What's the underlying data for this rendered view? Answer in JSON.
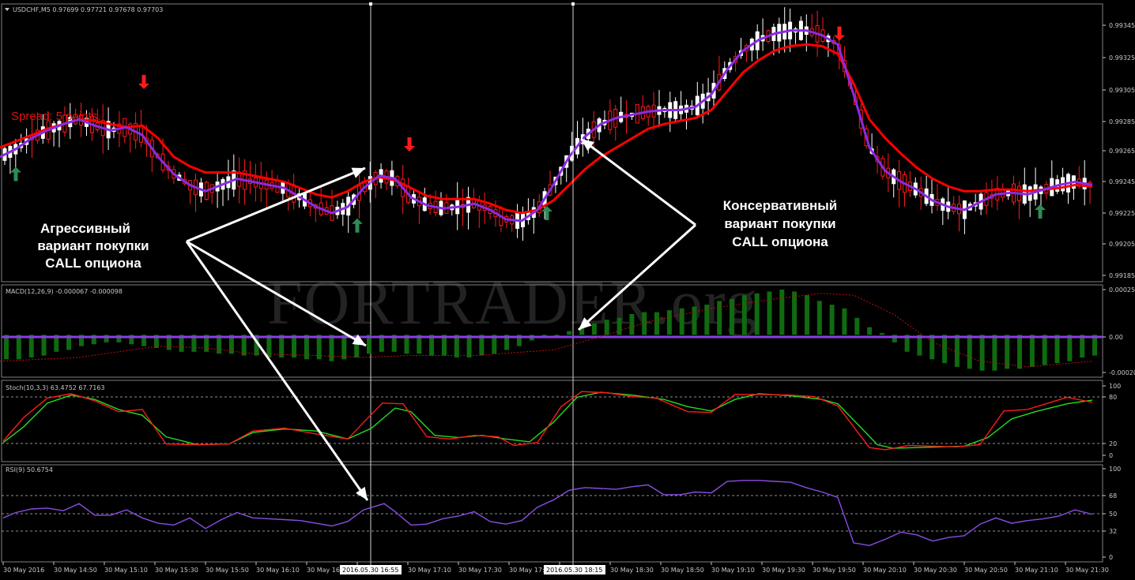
{
  "colors": {
    "background": "#000000",
    "frame": "#808080",
    "grid": "#c0c0c0",
    "bull_candle": "#ffffff",
    "bear_candle": "#ff1a1a",
    "fast_ma": "#8a2be2",
    "slow_ma": "#ff0000",
    "macd_hist": "#0f6b0f",
    "macd_signal": "#c01010",
    "stoch_main": "#ff1a1a",
    "stoch_signal": "#22dd22",
    "rsi_line": "#8a4de2",
    "arrow_up": "#2e8b57",
    "arrow_down": "#ff1a1a",
    "annotation": "#ffffff"
  },
  "main_panel": {
    "label": "USDCHF,M5  0.97699 0.97721 0.97678 0.97703",
    "menu_icon": "triangle-down-icon",
    "price_ticks": [
      "0.99345",
      "0.99325",
      "0.99305",
      "0.99285",
      "0.99265",
      "0.99245",
      "0.99225",
      "0.99205",
      "0.99185"
    ],
    "spread_text": "Spread: 5 points."
  },
  "annotations": {
    "aggressive": [
      "Агрессивный",
      "вариант покупки",
      "CALL опциона"
    ],
    "conservative": [
      "Консервативный",
      "вариант покупки",
      "CALL опциона"
    ]
  },
  "watermark": "FORTRADER.org",
  "macd_panel": {
    "label": "MACD(12,26,9) -0.000067 -0.000098",
    "ticks": [
      "0.000255",
      "0.00",
      "-0.000203"
    ]
  },
  "stoch_panel": {
    "label": "Stoch(10,3,3) 63.4752 67.7163",
    "ticks": [
      "100",
      "80",
      "20",
      "0"
    ]
  },
  "rsi_panel": {
    "label": "RSI(9) 50.6754",
    "ticks": [
      "100",
      "68",
      "50",
      "32",
      "0"
    ]
  },
  "time_axis": {
    "labels": [
      "30 May 2016",
      "30 May 14:50",
      "30 May 15:10",
      "30 May 15:30",
      "30 May 15:50",
      "30 May 16:10",
      "30 May 16:30",
      "30 May 16:55",
      "30 May 17:10",
      "30 May 17:30",
      "30 May 17:50",
      "30 May 18:15",
      "30 May 18:30",
      "30 May 18:50",
      "30 May 19:10",
      "30 May 19:30",
      "30 May 19:50",
      "30 May 20:10",
      "30 May 20:30",
      "30 May 20:50",
      "30 May 21:10",
      "30 May 21:30"
    ],
    "crosshair_labels": [
      "2016.05.30 16:55",
      "2016.05.30 18:15"
    ]
  },
  "chart_data": {
    "type": "candlestick",
    "symbol": "USDCHF",
    "timeframe": "M5",
    "price_range": [
      0.99178,
      0.99356
    ],
    "slow_ma_pts": [
      [
        0,
        0.99264
      ],
      [
        20,
        0.99268
      ],
      [
        40,
        0.99272
      ],
      [
        60,
        0.99276
      ],
      [
        80,
        0.99279
      ],
      [
        100,
        0.99282
      ],
      [
        120,
        0.99281
      ],
      [
        140,
        0.99279
      ],
      [
        160,
        0.99277
      ],
      [
        180,
        0.99278
      ],
      [
        200,
        0.9927
      ],
      [
        220,
        0.99258
      ],
      [
        240,
        0.99252
      ],
      [
        260,
        0.99248
      ],
      [
        280,
        0.99248
      ],
      [
        300,
        0.99248
      ],
      [
        320,
        0.99246
      ],
      [
        340,
        0.99244
      ],
      [
        360,
        0.99242
      ],
      [
        380,
        0.99238
      ],
      [
        400,
        0.99234
      ],
      [
        420,
        0.99232
      ],
      [
        440,
        0.99236
      ],
      [
        460,
        0.99242
      ],
      [
        480,
        0.99245
      ],
      [
        500,
        0.99243
      ],
      [
        520,
        0.99238
      ],
      [
        540,
        0.99233
      ],
      [
        560,
        0.99231
      ],
      [
        580,
        0.99231
      ],
      [
        600,
        0.99231
      ],
      [
        620,
        0.99228
      ],
      [
        640,
        0.99224
      ],
      [
        660,
        0.99222
      ],
      [
        680,
        0.99224
      ],
      [
        700,
        0.9923
      ],
      [
        720,
        0.9924
      ],
      [
        740,
        0.9925
      ],
      [
        760,
        0.99258
      ],
      [
        780,
        0.99264
      ],
      [
        800,
        0.9927
      ],
      [
        820,
        0.99276
      ],
      [
        840,
        0.99279
      ],
      [
        860,
        0.99281
      ],
      [
        880,
        0.99283
      ],
      [
        900,
        0.99288
      ],
      [
        920,
        0.993
      ],
      [
        940,
        0.99312
      ],
      [
        960,
        0.9932
      ],
      [
        980,
        0.99326
      ],
      [
        1000,
        0.99329
      ],
      [
        1020,
        0.9933
      ],
      [
        1040,
        0.99329
      ],
      [
        1060,
        0.99324
      ],
      [
        1080,
        0.99305
      ],
      [
        1100,
        0.99282
      ],
      [
        1120,
        0.9927
      ],
      [
        1140,
        0.9926
      ],
      [
        1160,
        0.99251
      ],
      [
        1180,
        0.99244
      ],
      [
        1200,
        0.99239
      ],
      [
        1220,
        0.99236
      ],
      [
        1240,
        0.99236
      ],
      [
        1260,
        0.99237
      ],
      [
        1280,
        0.99237
      ],
      [
        1300,
        0.99236
      ],
      [
        1320,
        0.99237
      ],
      [
        1340,
        0.99238
      ],
      [
        1360,
        0.9924
      ],
      [
        1382,
        0.99239
      ]
    ],
    "fast_ma_pts": [
      [
        0,
        0.99258
      ],
      [
        20,
        0.99263
      ],
      [
        40,
        0.9927
      ],
      [
        60,
        0.99275
      ],
      [
        80,
        0.99279
      ],
      [
        100,
        0.99282
      ],
      [
        120,
        0.99278
      ],
      [
        140,
        0.99275
      ],
      [
        160,
        0.99277
      ],
      [
        180,
        0.99272
      ],
      [
        200,
        0.99258
      ],
      [
        220,
        0.99247
      ],
      [
        240,
        0.9924
      ],
      [
        260,
        0.99236
      ],
      [
        280,
        0.9924
      ],
      [
        300,
        0.99244
      ],
      [
        320,
        0.99242
      ],
      [
        340,
        0.9924
      ],
      [
        360,
        0.99238
      ],
      [
        380,
        0.99232
      ],
      [
        400,
        0.99226
      ],
      [
        420,
        0.99222
      ],
      [
        440,
        0.99226
      ],
      [
        460,
        0.99238
      ],
      [
        480,
        0.99246
      ],
      [
        500,
        0.99244
      ],
      [
        520,
        0.99232
      ],
      [
        540,
        0.99227
      ],
      [
        560,
        0.99225
      ],
      [
        580,
        0.99226
      ],
      [
        600,
        0.99228
      ],
      [
        620,
        0.99224
      ],
      [
        640,
        0.99218
      ],
      [
        660,
        0.99217
      ],
      [
        680,
        0.99224
      ],
      [
        700,
        0.9924
      ],
      [
        720,
        0.99258
      ],
      [
        740,
        0.99271
      ],
      [
        760,
        0.99279
      ],
      [
        780,
        0.99283
      ],
      [
        800,
        0.99285
      ],
      [
        820,
        0.99287
      ],
      [
        840,
        0.99288
      ],
      [
        860,
        0.99288
      ],
      [
        880,
        0.9929
      ],
      [
        900,
        0.99298
      ],
      [
        920,
        0.99314
      ],
      [
        940,
        0.99326
      ],
      [
        960,
        0.99333
      ],
      [
        980,
        0.99337
      ],
      [
        1000,
        0.99339
      ],
      [
        1020,
        0.99339
      ],
      [
        1040,
        0.99336
      ],
      [
        1060,
        0.9933
      ],
      [
        1080,
        0.99298
      ],
      [
        1100,
        0.99264
      ],
      [
        1120,
        0.99249
      ],
      [
        1140,
        0.99242
      ],
      [
        1160,
        0.99237
      ],
      [
        1180,
        0.9923
      ],
      [
        1200,
        0.99226
      ],
      [
        1220,
        0.99224
      ],
      [
        1240,
        0.99229
      ],
      [
        1260,
        0.99234
      ],
      [
        1280,
        0.99235
      ],
      [
        1300,
        0.99234
      ],
      [
        1320,
        0.99237
      ],
      [
        1340,
        0.9924
      ],
      [
        1360,
        0.99242
      ],
      [
        1382,
        0.9924
      ]
    ],
    "up_arrows": [
      [
        20,
        0.99247
      ],
      [
        452,
        0.99214
      ],
      [
        692,
        0.99222
      ],
      [
        1316,
        0.99223
      ]
    ],
    "down_arrows": [
      [
        182,
        0.99306
      ],
      [
        518,
        0.99266
      ],
      [
        1062,
        0.99337
      ]
    ],
    "macd": {
      "range": [
        -0.000225,
        0.000265
      ],
      "histogram": [
        -0.00013,
        -0.00013,
        -0.00012,
        -0.00011,
        -9e-05,
        -8e-05,
        -6e-05,
        -5e-05,
        -4e-05,
        -4e-05,
        -5e-05,
        -6e-05,
        -7e-05,
        -8e-05,
        -9e-05,
        -9e-05,
        -9e-05,
        -0.0001,
        -0.0001,
        -0.00011,
        -0.00011,
        -0.00012,
        -0.00012,
        -0.00012,
        -0.00013,
        -0.00013,
        -0.00014,
        -0.00013,
        -0.00012,
        -0.0001,
        -9e-05,
        -9e-05,
        -0.0001,
        -0.0001,
        -0.00011,
        -0.00011,
        -0.00012,
        -0.00012,
        -0.00011,
        -0.0001,
        -8e-05,
        -6e-05,
        -3e-05,
        -1e-05,
        -1e-05,
        2e-05,
        4e-05,
        6e-05,
        8e-05,
        9e-05,
        0.00011,
        0.00012,
        0.00012,
        0.00013,
        0.00014,
        0.00015,
        0.00016,
        0.00018,
        0.00019,
        0.00021,
        0.00022,
        0.00023,
        0.00024,
        0.00023,
        0.00021,
        0.00018,
        0.00016,
        0.00014,
        9e-05,
        4e-05,
        1e-05,
        -4e-05,
        -9e-05,
        -0.00011,
        -0.00013,
        -0.00015,
        -0.00017,
        -0.00018,
        -0.00019,
        -0.00019,
        -0.00018,
        -0.00018,
        -0.00017,
        -0.00016,
        -0.00015,
        -0.00014,
        -0.00012,
        -0.00011
      ],
      "signal_pts": [
        [
          0,
          -0.00014
        ],
        [
          100,
          -0.00012
        ],
        [
          200,
          -6e-05
        ],
        [
          260,
          -7e-05
        ],
        [
          320,
          -0.0001
        ],
        [
          400,
          -0.00011
        ],
        [
          460,
          -0.00012
        ],
        [
          520,
          -0.00011
        ],
        [
          600,
          -0.00011
        ],
        [
          700,
          -8e-05
        ],
        [
          760,
          -1e-05
        ],
        [
          820,
          7e-05
        ],
        [
          900,
          0.00014
        ],
        [
          980,
          0.00019
        ],
        [
          1040,
          0.00022
        ],
        [
          1080,
          0.00021
        ],
        [
          1130,
          0.00011
        ],
        [
          1180,
          -4e-05
        ],
        [
          1240,
          -0.00014
        ],
        [
          1300,
          -0.00017
        ],
        [
          1382,
          -0.00014
        ]
      ]
    },
    "stoch": {
      "main_pts": [
        [
          4,
          22
        ],
        [
          30,
          55
        ],
        [
          60,
          82
        ],
        [
          90,
          88
        ],
        [
          120,
          78
        ],
        [
          150,
          63
        ],
        [
          180,
          66
        ],
        [
          210,
          18
        ],
        [
          250,
          17
        ],
        [
          290,
          18
        ],
        [
          320,
          36
        ],
        [
          360,
          40
        ],
        [
          400,
          32
        ],
        [
          440,
          25
        ],
        [
          460,
          48
        ],
        [
          484,
          75
        ],
        [
          510,
          74
        ],
        [
          540,
          28
        ],
        [
          570,
          25
        ],
        [
          600,
          30
        ],
        [
          630,
          28
        ],
        [
          650,
          16
        ],
        [
          680,
          20
        ],
        [
          710,
          70
        ],
        [
          736,
          91
        ],
        [
          770,
          89
        ],
        [
          800,
          84
        ],
        [
          830,
          82
        ],
        [
          870,
          63
        ],
        [
          900,
          62
        ],
        [
          930,
          87
        ],
        [
          960,
          87
        ],
        [
          1000,
          86
        ],
        [
          1030,
          84
        ],
        [
          1060,
          71
        ],
        [
          1084,
          36
        ],
        [
          1100,
          13
        ],
        [
          1120,
          10
        ],
        [
          1150,
          16
        ],
        [
          1180,
          15
        ],
        [
          1210,
          14
        ],
        [
          1240,
          17
        ],
        [
          1270,
          64
        ],
        [
          1300,
          66
        ],
        [
          1350,
          83
        ],
        [
          1382,
          76
        ]
      ],
      "signal_pts": [
        [
          4,
          20
        ],
        [
          30,
          42
        ],
        [
          60,
          75
        ],
        [
          90,
          86
        ],
        [
          120,
          80
        ],
        [
          150,
          66
        ],
        [
          180,
          58
        ],
        [
          210,
          28
        ],
        [
          250,
          17
        ],
        [
          290,
          18
        ],
        [
          320,
          34
        ],
        [
          360,
          39
        ],
        [
          400,
          36
        ],
        [
          440,
          25
        ],
        [
          470,
          40
        ],
        [
          500,
          68
        ],
        [
          520,
          63
        ],
        [
          550,
          30
        ],
        [
          580,
          27
        ],
        [
          610,
          30
        ],
        [
          640,
          25
        ],
        [
          670,
          21
        ],
        [
          700,
          48
        ],
        [
          730,
          83
        ],
        [
          760,
          90
        ],
        [
          800,
          86
        ],
        [
          840,
          80
        ],
        [
          870,
          70
        ],
        [
          900,
          64
        ],
        [
          930,
          80
        ],
        [
          960,
          88
        ],
        [
          1000,
          85
        ],
        [
          1040,
          80
        ],
        [
          1060,
          74
        ],
        [
          1090,
          40
        ],
        [
          1110,
          17
        ],
        [
          1130,
          12
        ],
        [
          1160,
          13
        ],
        [
          1190,
          14
        ],
        [
          1220,
          15
        ],
        [
          1250,
          27
        ],
        [
          1280,
          53
        ],
        [
          1310,
          63
        ],
        [
          1350,
          74
        ],
        [
          1382,
          79
        ]
      ]
    },
    "rsi": {
      "pts": [
        [
          4,
          44
        ],
        [
          20,
          50
        ],
        [
          40,
          54
        ],
        [
          60,
          55
        ],
        [
          80,
          52
        ],
        [
          100,
          60
        ],
        [
          120,
          47
        ],
        [
          140,
          47
        ],
        [
          160,
          53
        ],
        [
          180,
          44
        ],
        [
          200,
          38
        ],
        [
          220,
          36
        ],
        [
          240,
          44
        ],
        [
          260,
          32
        ],
        [
          280,
          42
        ],
        [
          300,
          50
        ],
        [
          320,
          44
        ],
        [
          340,
          43
        ],
        [
          360,
          42
        ],
        [
          380,
          41
        ],
        [
          400,
          38
        ],
        [
          420,
          35
        ],
        [
          440,
          40
        ],
        [
          460,
          53
        ],
        [
          486,
          60
        ],
        [
          500,
          51
        ],
        [
          520,
          36
        ],
        [
          540,
          37
        ],
        [
          560,
          43
        ],
        [
          580,
          46
        ],
        [
          600,
          51
        ],
        [
          620,
          40
        ],
        [
          640,
          37
        ],
        [
          660,
          41
        ],
        [
          680,
          56
        ],
        [
          700,
          64
        ],
        [
          720,
          75
        ],
        [
          740,
          78
        ],
        [
          760,
          77
        ],
        [
          780,
          76
        ],
        [
          800,
          79
        ],
        [
          820,
          81
        ],
        [
          840,
          70
        ],
        [
          860,
          70
        ],
        [
          880,
          73
        ],
        [
          900,
          72
        ],
        [
          920,
          85
        ],
        [
          940,
          86
        ],
        [
          960,
          86
        ],
        [
          980,
          85
        ],
        [
          1000,
          84
        ],
        [
          1020,
          78
        ],
        [
          1040,
          73
        ],
        [
          1060,
          67
        ],
        [
          1080,
          16
        ],
        [
          1100,
          13
        ],
        [
          1120,
          20
        ],
        [
          1140,
          28
        ],
        [
          1160,
          25
        ],
        [
          1180,
          18
        ],
        [
          1200,
          22
        ],
        [
          1220,
          24
        ],
        [
          1240,
          37
        ],
        [
          1260,
          44
        ],
        [
          1280,
          38
        ],
        [
          1300,
          41
        ],
        [
          1320,
          43
        ],
        [
          1340,
          46
        ],
        [
          1360,
          53
        ],
        [
          1382,
          48
        ]
      ]
    }
  }
}
